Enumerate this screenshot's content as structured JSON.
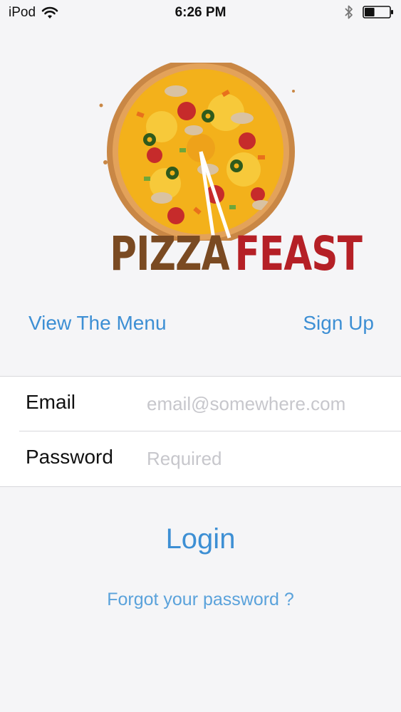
{
  "status_bar": {
    "carrier": "iPod",
    "time": "6:26 PM",
    "battery_level": 0.4
  },
  "logo": {
    "word_1": "PIZZA",
    "word_2": "FEAST",
    "colors": {
      "word_1": "#7a4a22",
      "word_2": "#b52026",
      "crust": "#c98745",
      "cheese": "#f3b11b"
    }
  },
  "links": {
    "view_menu": "View The Menu",
    "sign_up": "Sign Up"
  },
  "form": {
    "email_label": "Email",
    "email_placeholder": "email@somewhere.com",
    "email_value": "",
    "password_label": "Password",
    "password_placeholder": "Required",
    "password_value": ""
  },
  "actions": {
    "login": "Login",
    "forgot_password": "Forgot your password ?"
  },
  "theme": {
    "accent": "#3d8fd4",
    "background": "#f5f5f7"
  }
}
